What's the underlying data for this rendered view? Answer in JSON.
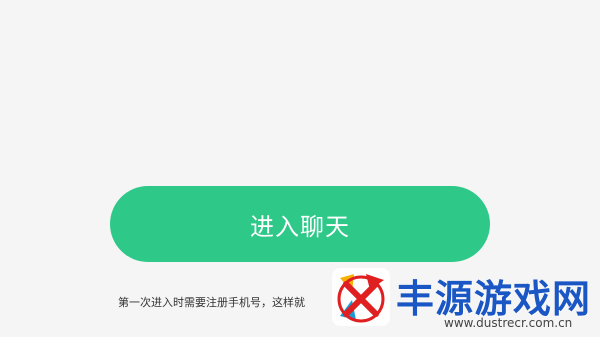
{
  "main": {
    "enter_chat_label": "进入聊天",
    "hint_text": "第一次进入时需要注册手机号，这样就"
  },
  "watermark": {
    "title": "丰源游戏网",
    "url": "www.dustrecr.com.cn"
  },
  "colors": {
    "background": "#f5f5f5",
    "accent_green": "#2ec888",
    "watermark_blue": "#1a56c4"
  }
}
